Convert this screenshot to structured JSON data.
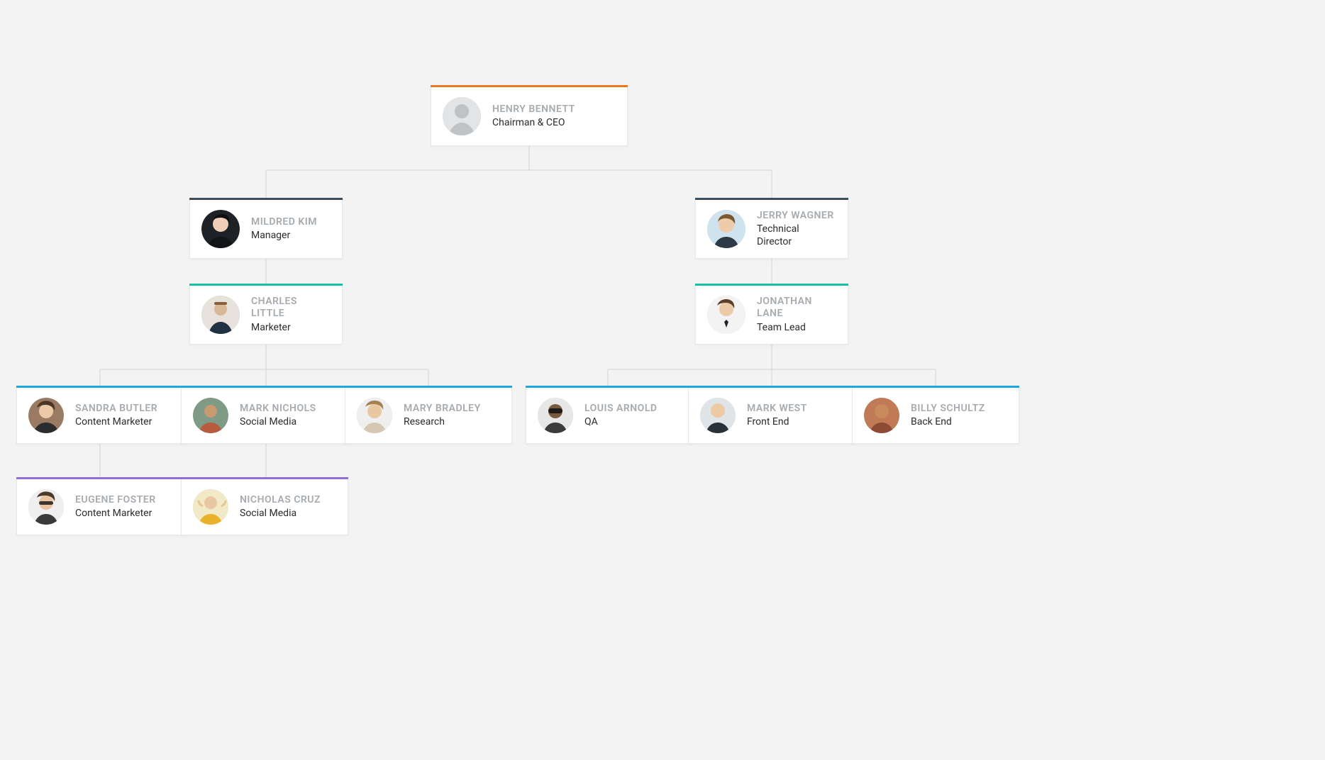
{
  "colors": {
    "orange": "#ed7820",
    "slate": "#3c4d5c",
    "teal": "#12c2a2",
    "blue": "#1aa9df",
    "violet": "#8f6fd6"
  },
  "people": {
    "ceo": {
      "name": "HENRY BENNETT",
      "role": "Chairman & CEO"
    },
    "mgr": {
      "name": "MILDRED KIM",
      "role": "Manager"
    },
    "td": {
      "name": "JERRY WAGNER",
      "role": "Technical Director"
    },
    "marketer": {
      "name": "CHARLES LITTLE",
      "role": "Marketer"
    },
    "teamlead": {
      "name": "JONATHAN LANE",
      "role": "Team Lead"
    },
    "content1": {
      "name": "SANDRA BUTLER",
      "role": "Content Marketer"
    },
    "social1": {
      "name": "MARK NICHOLS",
      "role": "Social Media"
    },
    "research": {
      "name": "MARY BRADLEY",
      "role": "Research"
    },
    "qa": {
      "name": "LOUIS ARNOLD",
      "role": "QA"
    },
    "fe": {
      "name": "MARK WEST",
      "role": "Front End"
    },
    "be": {
      "name": "BILLY SCHULTZ",
      "role": "Back End"
    },
    "content2": {
      "name": "EUGENE FOSTER",
      "role": "Content Marketer"
    },
    "social2": {
      "name": "NICHOLAS CRUZ",
      "role": "Social Media"
    }
  }
}
